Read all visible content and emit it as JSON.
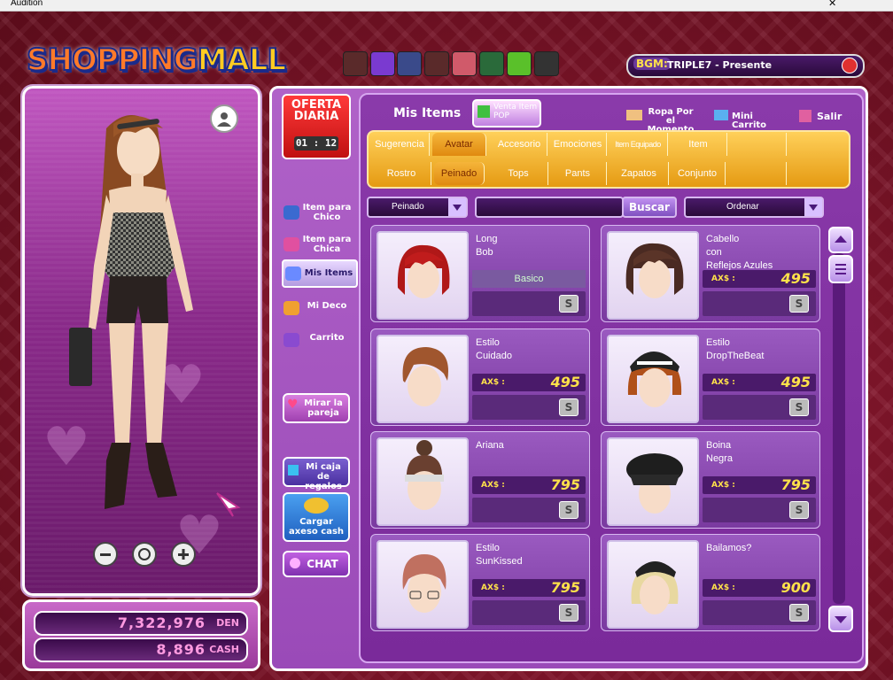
{
  "window": {
    "title": "Audition"
  },
  "logo": {
    "line1": "SHOPPING",
    "line2": "MALL"
  },
  "bgm": {
    "label": "BGM:",
    "song": "TRIPLE7 - Presente"
  },
  "currency": {
    "den_value": "7,322,976",
    "den_unit": "DEN",
    "cash_value": "8,896",
    "cash_unit": "CASH"
  },
  "oferta": {
    "title": "OFERTA DIARIA",
    "timer": "01 : 12"
  },
  "side_menu": {
    "chico": "Item para Chico",
    "chica": "Item para Chica",
    "mis_items": "Mis Items",
    "mi_deco": "Mi Deco",
    "carrito": "Carrito",
    "mirar_pareja": "Mirar la pareja",
    "caja_regalos": "Mi caja de regalos",
    "cargar": "Cargar axeso cash",
    "chat": "CHAT"
  },
  "header": {
    "title": "Mis Items",
    "venta_pop": "Venta Item POP",
    "ropa_momento": "Ropa Por el Momento",
    "mini_carrito": "Mini Carrito",
    "salir": "Salir"
  },
  "tabs_main": [
    "Sugerencia",
    "Avatar",
    "Accesorio",
    "Emociones",
    "Item Equipado",
    "Item",
    ""
  ],
  "tabs_sub": [
    "Rostro",
    "Peinado",
    "Tops",
    "Pants",
    "Zapatos",
    "Conjunto",
    ""
  ],
  "filters": {
    "category": "Peinado",
    "search_placeholder": "",
    "search_button": "Buscar",
    "sort": "Ordenar"
  },
  "items": [
    {
      "name1": "Long",
      "name2": "Bob",
      "name3": "",
      "price": "",
      "tag": "Basico",
      "axs": ""
    },
    {
      "name1": "Cabello",
      "name2": "con",
      "name3": "Reflejos Azules",
      "price": "495",
      "tag": "",
      "axs": "AX$ :"
    },
    {
      "name1": "Estilo",
      "name2": "Cuidado",
      "name3": "",
      "price": "495",
      "tag": "",
      "axs": "AX$ :"
    },
    {
      "name1": "Estilo",
      "name2": "DropTheBeat",
      "name3": "",
      "price": "495",
      "tag": "",
      "axs": "AX$ :"
    },
    {
      "name1": "Ariana",
      "name2": "",
      "name3": "",
      "price": "795",
      "tag": "",
      "axs": "AX$ :"
    },
    {
      "name1": "Boina",
      "name2": "Negra",
      "name3": "",
      "price": "795",
      "tag": "",
      "axs": "AX$ :"
    },
    {
      "name1": "Estilo",
      "name2": "SunKissed",
      "name3": "",
      "price": "795",
      "tag": "",
      "axs": "AX$ :"
    },
    {
      "name1": "Bailamos?",
      "name2": "",
      "name3": "",
      "price": "900",
      "tag": "",
      "axs": "AX$ :"
    }
  ],
  "s_button": "S",
  "colors": {
    "accent_orange": "#f5b53a",
    "panel_purple": "#9a4ab8",
    "price_yellow": "#ffe24a"
  }
}
